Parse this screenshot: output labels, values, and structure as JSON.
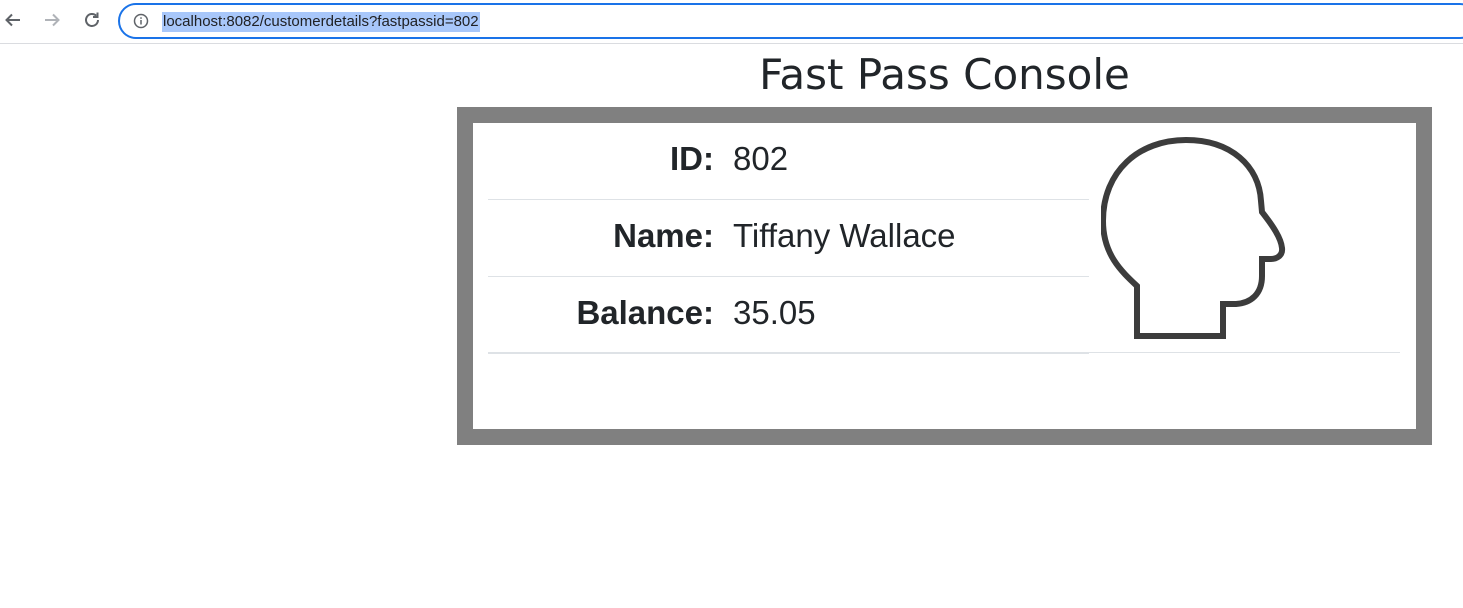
{
  "browser": {
    "url": "localhost:8082/customerdetails?fastpassid=802",
    "icons": {
      "back": "arrow-left-icon",
      "forward": "arrow-right-icon",
      "reload": "reload-icon",
      "info": "info-icon"
    }
  },
  "page": {
    "title": "Fast Pass Console"
  },
  "customer": {
    "rows": [
      {
        "label": "ID:",
        "value": "802"
      },
      {
        "label": "Name:",
        "value": "Tiffany Wallace"
      },
      {
        "label": "Balance:",
        "value": "35.05"
      }
    ],
    "avatar_icon": "person-head-icon"
  },
  "colors": {
    "accent": "#1a73e8",
    "card_border": "#808080",
    "text": "#212529"
  }
}
